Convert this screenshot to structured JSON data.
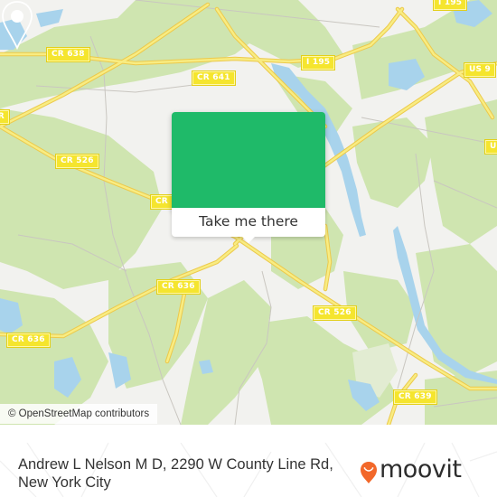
{
  "map": {
    "road_labels": [
      {
        "id": "cr638",
        "text": "CR 638"
      },
      {
        "id": "cr641",
        "text": "CR 641"
      },
      {
        "id": "i195-mid",
        "text": "I 195"
      },
      {
        "id": "i195-top",
        "text": "I 195"
      },
      {
        "id": "us9",
        "text": "US 9"
      },
      {
        "id": "us-edge",
        "text": "U"
      },
      {
        "id": "cr526-left",
        "text": "CR 526"
      },
      {
        "id": "cr-left-edge",
        "text": "CR"
      },
      {
        "id": "cr-mid-left",
        "text": "CR"
      },
      {
        "id": "cr636-mid",
        "text": "CR 636"
      },
      {
        "id": "cr636-left",
        "text": "CR 636"
      },
      {
        "id": "cr526-right",
        "text": "CR 526"
      },
      {
        "id": "cr639",
        "text": "CR 639"
      }
    ],
    "attribution": "© OpenStreetMap contributors",
    "colors": {
      "background": "#f2f2ef",
      "forest": "#cfe5b0",
      "water": "#a8d3ec",
      "road": "#f5e05a",
      "popup": "#1fba69"
    }
  },
  "popup": {
    "icon": "map-pin-icon",
    "button_label": "Take me there"
  },
  "footer": {
    "address": "Andrew L Nelson M D, 2290 W County Line Rd, New York City",
    "logo_text": "moovit",
    "logo_icon": "moovit-pin-logo-icon",
    "logo_color": "#f2682a"
  }
}
